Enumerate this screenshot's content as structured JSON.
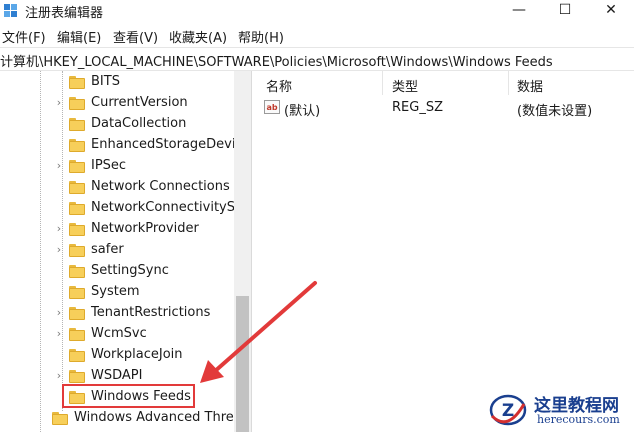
{
  "window": {
    "title": "注册表编辑器",
    "minimize_glyph": "—",
    "maximize_glyph": "☐",
    "close_glyph": "✕"
  },
  "menu": [
    "文件(F)",
    "编辑(E)",
    "查看(V)",
    "收藏夹(A)",
    "帮助(H)"
  ],
  "address": "计算机\\HKEY_LOCAL_MACHINE\\SOFTWARE\\Policies\\Microsoft\\Windows\\Windows Feeds",
  "tree": {
    "items": [
      {
        "label": "BITS",
        "expandable": false
      },
      {
        "label": "CurrentVersion",
        "expandable": true
      },
      {
        "label": "DataCollection",
        "expandable": false
      },
      {
        "label": "EnhancedStorageDevices",
        "expandable": false
      },
      {
        "label": "IPSec",
        "expandable": true
      },
      {
        "label": "Network Connections",
        "expandable": false
      },
      {
        "label": "NetworkConnectivityStatusIndicator",
        "expandable": false
      },
      {
        "label": "NetworkProvider",
        "expandable": true
      },
      {
        "label": "safer",
        "expandable": true
      },
      {
        "label": "SettingSync",
        "expandable": false
      },
      {
        "label": "System",
        "expandable": false
      },
      {
        "label": "TenantRestrictions",
        "expandable": true
      },
      {
        "label": "WcmSvc",
        "expandable": true
      },
      {
        "label": "WorkplaceJoin",
        "expandable": false
      },
      {
        "label": "WSDAPI",
        "expandable": true
      },
      {
        "label": "Windows Feeds",
        "expandable": false,
        "selected": true
      }
    ],
    "parent_sibling": {
      "label": "Windows Advanced Threat Protection",
      "expandable": false
    },
    "expander_glyph": "›"
  },
  "list": {
    "columns": [
      "名称",
      "类型",
      "数据"
    ],
    "rows": [
      {
        "name": "(默认)",
        "type": "REG_SZ",
        "data": "(数值未设置)"
      }
    ],
    "value_icon_text": "ab"
  },
  "watermark": {
    "title": "这里教程网",
    "url": "herecours.com",
    "logo_letter": "Z"
  },
  "colors": {
    "highlight": "#e23a3a",
    "folder": "#f7cf5a",
    "watermark_blue": "#1a3f8f",
    "watermark_red": "#d32f2f"
  }
}
